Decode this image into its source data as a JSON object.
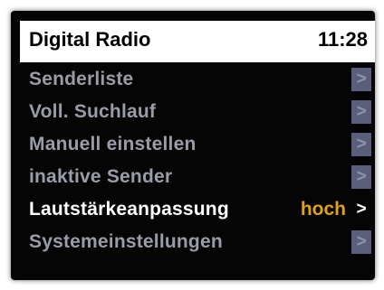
{
  "header": {
    "title": "Digital Radio",
    "time": "11:28"
  },
  "menu": {
    "items": [
      {
        "label": "Senderliste",
        "value": "",
        "arrow": ">"
      },
      {
        "label": "Voll. Suchlauf",
        "value": "",
        "arrow": ">"
      },
      {
        "label": "Manuell einstellen",
        "value": "",
        "arrow": ">"
      },
      {
        "label": "inaktive Sender",
        "value": "",
        "arrow": ">"
      },
      {
        "label": "Lautstärkeanpassung",
        "value": "hoch",
        "arrow": ">"
      },
      {
        "label": "Systemeinstellungen",
        "value": "",
        "arrow": ">"
      }
    ]
  },
  "colors": {
    "background": "#050505",
    "header_bg": "#ffffff",
    "item_text": "#9a9ca8",
    "selected_text": "#ffffff",
    "value_text": "#e0a020",
    "chevron_bg": "#5a5e78"
  },
  "icons": {
    "chevron": "chevron-right-icon"
  }
}
